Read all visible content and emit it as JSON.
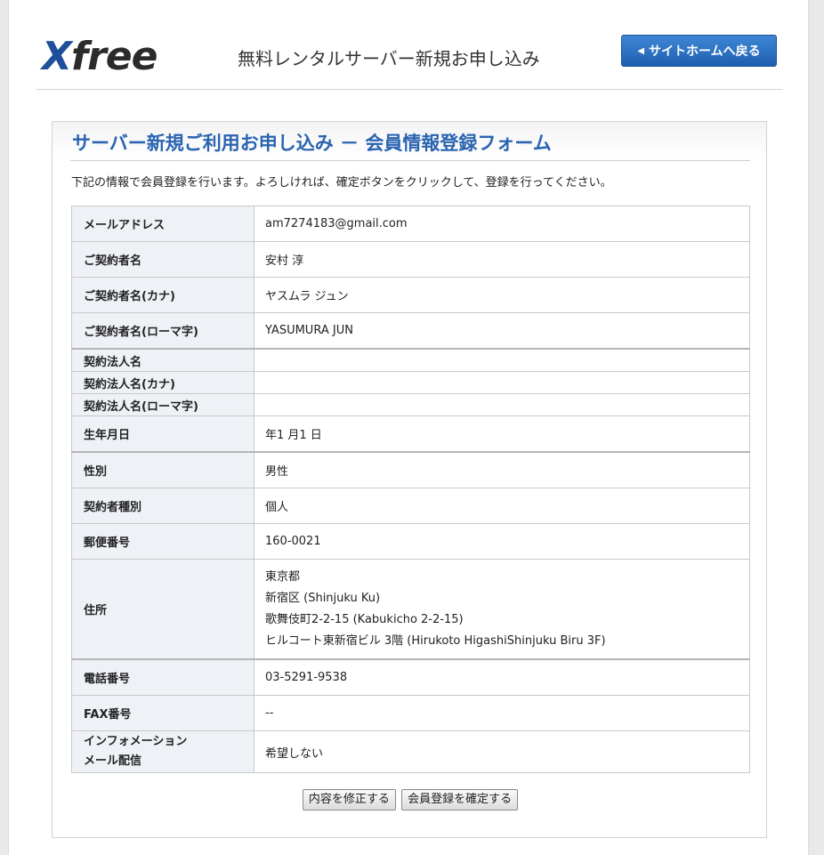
{
  "header": {
    "logo_x": "X",
    "logo_rest": "free",
    "title": "無料レンタルサーバー新規お申し込み",
    "home_button": "サイトホームへ戻る"
  },
  "form": {
    "title": "サーバー新規ご利用お申し込み － 会員情報登録フォーム",
    "intro": "下記の情報で会員登録を行います。よろしければ、確定ボタンをクリックして、登録を行ってください。",
    "rows": [
      {
        "label": "メールアドレス",
        "value": "am7274183@gmail.com"
      },
      {
        "label": "ご契約者名",
        "value": "安村 淳"
      },
      {
        "label": "ご契約者名(カナ)",
        "value": "ヤスムラ ジュン"
      },
      {
        "label": "ご契約者名(ローマ字)",
        "value": "YASUMURA JUN"
      },
      {
        "label": "契約法人名",
        "value": ""
      },
      {
        "label": "契約法人名(カナ)",
        "value": ""
      },
      {
        "label": "契約法人名(ローマ字)",
        "value": ""
      },
      {
        "label": "生年月日",
        "value": "年1 月1 日"
      },
      {
        "label": "性別",
        "value": "男性"
      },
      {
        "label": "契約者種別",
        "value": "個人"
      },
      {
        "label": "郵便番号",
        "value": "160-0021"
      },
      {
        "label": "住所",
        "lines": [
          "東京都",
          "新宿区 (Shinjuku Ku)",
          "歌舞伎町2-2-15 (Kabukicho 2-2-15)",
          "ヒルコート東新宿ビル 3階 (Hirukoto HigashiShinjuku Biru 3F)"
        ]
      },
      {
        "label": "電話番号",
        "value": "03-5291-9538"
      },
      {
        "label": "FAX番号",
        "value": "--"
      },
      {
        "label_line1": "インフォメーション",
        "label_line2": "メール配信",
        "value": "希望しない"
      }
    ],
    "buttons": {
      "edit": "内容を修正する",
      "confirm": "会員登録を確定する"
    }
  }
}
